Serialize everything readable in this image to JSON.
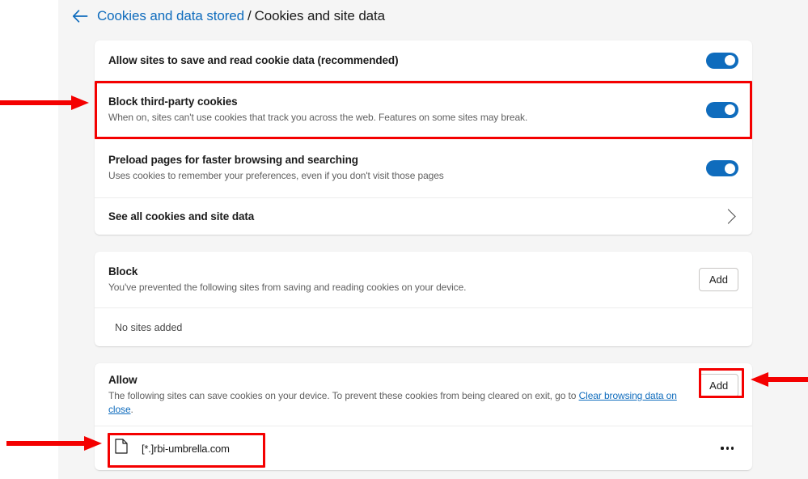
{
  "header": {
    "back_icon": "back-arrow-icon",
    "breadcrumb_parent": "Cookies and data stored",
    "breadcrumb_separator": "/",
    "breadcrumb_current": "Cookies and site data"
  },
  "settings_card": {
    "rows": [
      {
        "title": "Allow sites to save and read cookie data (recommended)",
        "description": "",
        "toggle": "on"
      },
      {
        "title": "Block third-party cookies",
        "description": "When on, sites can't use cookies that track you across the web. Features on some sites may break.",
        "toggle": "on"
      },
      {
        "title": "Preload pages for faster browsing and searching",
        "description": "Uses cookies to remember your preferences, even if you don't visit those pages",
        "toggle": "on"
      }
    ],
    "see_all": {
      "label": "See all cookies and site data",
      "icon": "chevron-right-icon"
    }
  },
  "block_card": {
    "title": "Block",
    "description": "You've prevented the following sites from saving and reading cookies on your device.",
    "add_label": "Add",
    "empty_label": "No sites added"
  },
  "allow_card": {
    "title": "Allow",
    "description_part1": "The following sites can save cookies on your device. To prevent these cookies from being cleared on exit, go to ",
    "description_link": "Clear browsing data on close",
    "description_part2": ".",
    "add_label": "Add",
    "sites": [
      {
        "icon": "document-icon",
        "name": "[*.]rbi-umbrella.com",
        "menu_icon": "more-options-icon"
      }
    ]
  },
  "annotations": {
    "highlight_color": "#f40000",
    "boxes": [
      "block-third-party-cookies-row",
      "allow-add-button",
      "allow-site-entry"
    ],
    "arrows": [
      "points-to-block-third-party-cookies",
      "points-to-allow-add-button",
      "points-to-allow-site-entry"
    ]
  },
  "colors": {
    "accent": "#0f6cbd",
    "page_background": "#f5f5f5",
    "card_background": "#ffffff",
    "text_primary": "#1b1b1b",
    "text_secondary": "#616161"
  }
}
